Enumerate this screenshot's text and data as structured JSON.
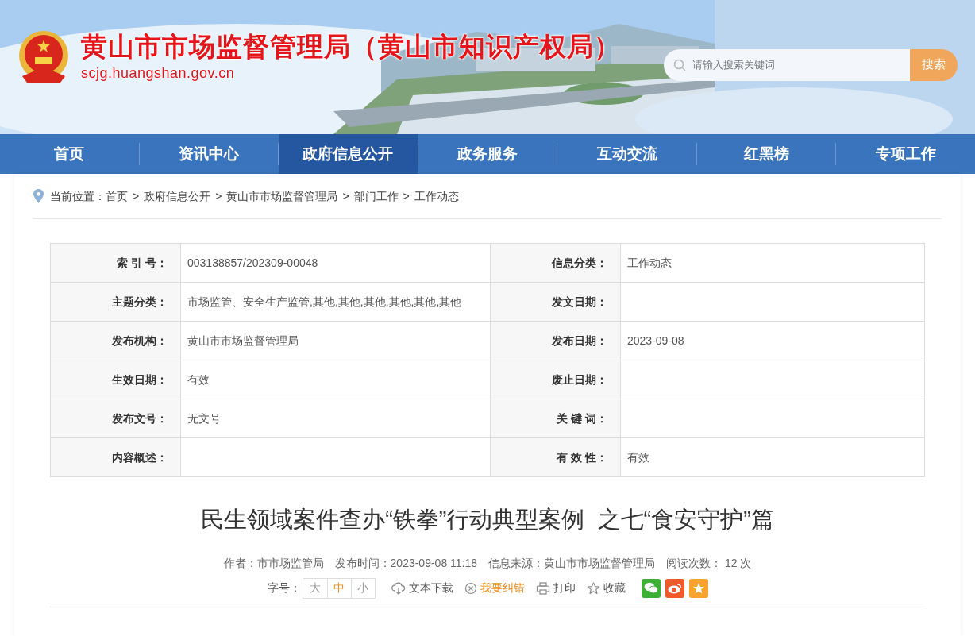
{
  "header": {
    "title": "黄山市市场监督管理局（黄山市知识产权局）",
    "domain": "scjg.huangshan.gov.cn",
    "search": {
      "placeholder": "请输入搜索关键词",
      "button": "搜索"
    }
  },
  "nav": [
    {
      "label": "首页",
      "selected": false
    },
    {
      "label": "资讯中心",
      "selected": false
    },
    {
      "label": "政府信息公开",
      "selected": true
    },
    {
      "label": "政务服务",
      "selected": false
    },
    {
      "label": "互动交流",
      "selected": false
    },
    {
      "label": "红黑榜",
      "selected": false
    },
    {
      "label": "专项工作",
      "selected": false
    }
  ],
  "breadcrumb": {
    "prefix": "当前位置：",
    "separator": ">",
    "items": [
      "首页",
      "政府信息公开",
      "黄山市市场监督管理局",
      "部门工作",
      "工作动态"
    ]
  },
  "info_table": {
    "rows": [
      [
        {
          "label": "索 引 号：",
          "value": "003138857/202309-00048"
        },
        {
          "label": "信息分类：",
          "value": "工作动态"
        }
      ],
      [
        {
          "label": "主题分类：",
          "value": "市场监管、安全生产监管,其他,其他,其他,其他,其他,其他"
        },
        {
          "label": "发文日期："
        }
      ],
      [
        {
          "label": "发布机构：",
          "value": "黄山市市场监督管理局"
        },
        {
          "label": "发布日期：",
          "value": "2023-09-08"
        }
      ],
      [
        {
          "label": "生效日期：",
          "value": "有效"
        },
        {
          "label": "废止日期："
        }
      ],
      [
        {
          "label": "发布文号：",
          "value": "无文号"
        },
        {
          "label": "关 键 词："
        }
      ],
      [
        {
          "label": "内容概述："
        },
        {
          "label": "有 效 性：",
          "value": "有效"
        }
      ]
    ]
  },
  "article": {
    "title": "民生领域案件查办“铁拳”行动典型案例  之七“食安守护”篇",
    "meta": [
      "作者：市市场监管局",
      "发布时间：2023-09-08 11:18",
      "信息来源：黄山市市场监督管理局",
      "阅读次数： 12 次"
    ],
    "font_size": {
      "label": "字号：",
      "options": [
        {
          "label": "大",
          "selected": false
        },
        {
          "label": "中",
          "selected": true
        },
        {
          "label": "小",
          "selected": false
        }
      ]
    },
    "actions": [
      {
        "label": "文本下载",
        "kind": "download",
        "highlighted": false
      },
      {
        "label": "我要纠错",
        "kind": "correction",
        "highlighted": true
      },
      {
        "label": "打印",
        "kind": "print",
        "highlighted": false
      },
      {
        "label": "收藏",
        "kind": "favorite",
        "highlighted": false
      }
    ]
  }
}
